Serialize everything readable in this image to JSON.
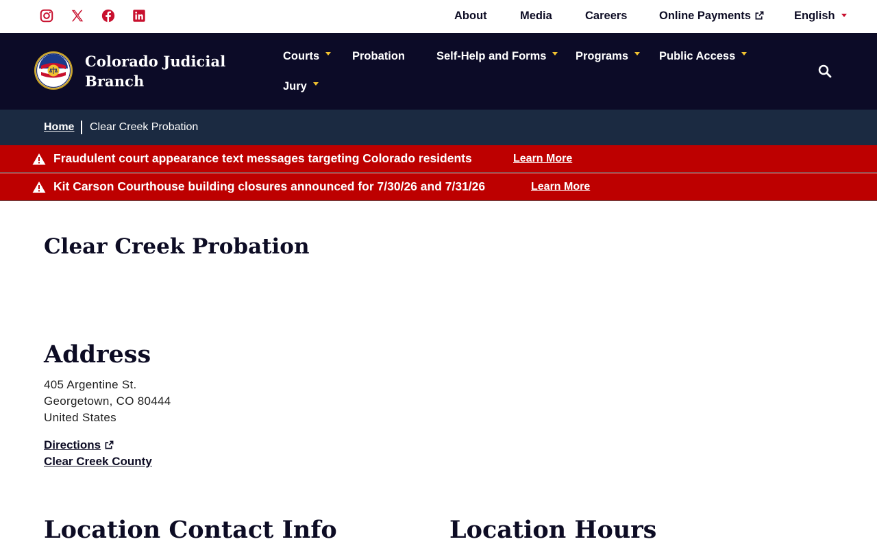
{
  "utility": {
    "social": [
      {
        "name": "instagram-icon"
      },
      {
        "name": "x-icon"
      },
      {
        "name": "facebook-icon"
      },
      {
        "name": "linkedin-icon"
      }
    ],
    "links": {
      "about": "About",
      "media": "Media",
      "careers": "Careers",
      "payments": "Online Payments",
      "language": "English"
    },
    "social_color": "#c8102e"
  },
  "header": {
    "site_name_line1": "Colorado Judicial",
    "site_name_line2": "Branch",
    "nav": {
      "courts": "Courts",
      "probation": "Probation",
      "self_help": "Self-Help and Forms",
      "programs": "Programs",
      "public_access": "Public Access",
      "jury": "Jury"
    },
    "background": "#0c0b27",
    "accent": "#f2c230"
  },
  "breadcrumb": {
    "home": "Home",
    "current": "Clear Creek Probation"
  },
  "alerts": [
    {
      "text": "Fraudulent court appearance text messages targeting Colorado residents",
      "link": "Learn More"
    },
    {
      "text": "Kit Carson Courthouse building closures announced for 7/30/26 and 7/31/26",
      "link": "Learn More"
    }
  ],
  "alert_color": "#bd0000",
  "main": {
    "title": "Clear Creek Probation",
    "address_heading": "Address",
    "address_lines": [
      "405 Argentine St.",
      "Georgetown, CO 80444",
      "United States"
    ],
    "directions": "Directions",
    "county": "Clear Creek County",
    "contact_heading": "Location Contact Info",
    "hours_heading": "Location Hours"
  }
}
